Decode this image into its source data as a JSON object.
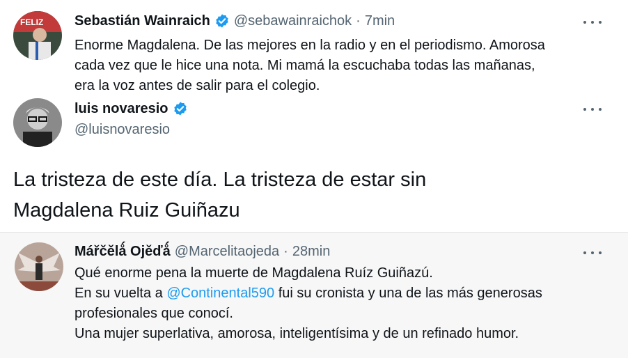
{
  "tweets": [
    {
      "name": "Sebastián Wainraich",
      "handle": "@sebawainraichok",
      "separator": "·",
      "time": "7min",
      "lines": [
        "Enorme Magdalena. De las mejores en la radio y en el periodismo. Amorosa",
        "cada vez que le hice una nota. Mi mamá la escuchaba todas las mañanas,",
        "era la voz antes de salir para el colegio."
      ],
      "verified": true,
      "avatar_icon": "profile-photo"
    },
    {
      "name": "luis novaresio",
      "handle": "@luisnovaresio",
      "lines": [
        "La tristeza de este día.  La tristeza de estar sin",
        "Magdalena Ruiz Guiñazu"
      ],
      "verified": true,
      "avatar_icon": "profile-photo"
    },
    {
      "name": "Mářčělǻ Ojěďǻ",
      "handle": "@Marcelitaojeda",
      "separator": "·",
      "time": "28min",
      "line1": "Qué enorme pena  la muerte de Magdalena Ruíz Guiñazú.",
      "line2_prefix": "En su vuelta a ",
      "line2_mention": "@Continental590",
      "line2_suffix": " fui su cronista y una de las más generosas",
      "line3": "profesionales que conocí.",
      "line4": "Una mujer superlativa, amorosa, inteligentísima y de un refinado humor.",
      "verified": false,
      "avatar_icon": "profile-photo"
    }
  ],
  "colors": {
    "text": "#0f1419",
    "secondary": "#536471",
    "link": "#1d9bf0",
    "verified": "#1d9bf0"
  }
}
